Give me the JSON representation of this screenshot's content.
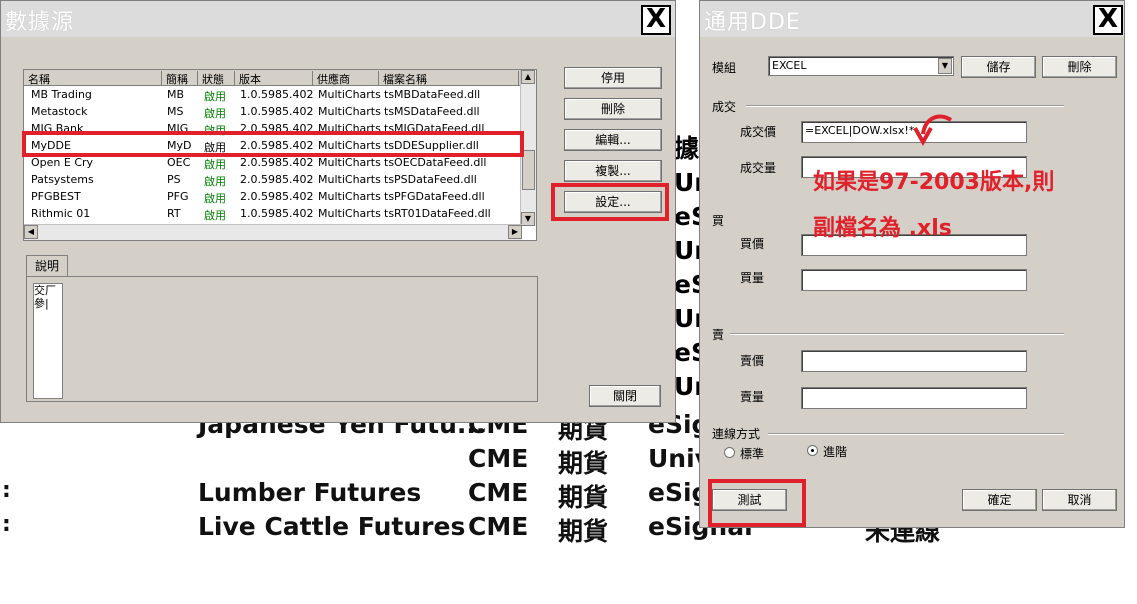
{
  "background": {
    "rows": [
      {
        "colon": "",
        "name": "Japanese Yen Futu...",
        "exchange": "CME",
        "type": "期貨",
        "feed": "eSig",
        "status": ""
      },
      {
        "colon": "",
        "name": "",
        "exchange": "CME",
        "type": "期貨",
        "feed": "Univ",
        "status": ""
      },
      {
        "colon": ":",
        "name": "Lumber Futures",
        "exchange": "CME",
        "type": "期貨",
        "feed": "eSig",
        "status": ""
      },
      {
        "colon": ":",
        "name": "Live Cattle Futures",
        "exchange": "CME",
        "type": "期貨",
        "feed": "eSignal",
        "status": "未連線"
      }
    ],
    "side_fragments": [
      "據",
      "Univ",
      "eSig",
      "Univ",
      "eSig",
      "Univ",
      "eSig",
      "Univ"
    ]
  },
  "datasource_window": {
    "title": "數據源",
    "close": "X",
    "columns": [
      "名稱",
      "簡稱",
      "狀態",
      "版本",
      "供應商",
      "檔案名稱"
    ],
    "rows": [
      {
        "name": "MB Trading",
        "short": "MB",
        "status": "啟用",
        "version": "1.0.5985.402",
        "vendor": "MultiCharts",
        "file": "tsMBDataFeed.dll"
      },
      {
        "name": "Metastock",
        "short": "MS",
        "status": "啟用",
        "version": "1.0.5985.402",
        "vendor": "MultiCharts",
        "file": "tsMSDataFeed.dll"
      },
      {
        "name": "MIG Bank",
        "short": "MIG",
        "status": "啟用",
        "version": "2.0.5985.402",
        "vendor": "MultiCharts",
        "file": "tsMIGDataFeed.dll"
      },
      {
        "name": "MyDDE",
        "short": "MyD",
        "status": "啟用",
        "version": "2.0.5985.402",
        "vendor": "MultiCharts",
        "file": "tsDDESupplier.dll"
      },
      {
        "name": "Open E Cry",
        "short": "OEC",
        "status": "啟用",
        "version": "2.0.5985.402",
        "vendor": "MultiCharts",
        "file": "tsOECDataFeed.dll"
      },
      {
        "name": "Patsystems",
        "short": "PS",
        "status": "啟用",
        "version": "2.0.5985.402",
        "vendor": "MultiCharts",
        "file": "tsPSDataFeed.dll"
      },
      {
        "name": "PFGBEST",
        "short": "PFG",
        "status": "啟用",
        "version": "2.0.5985.402",
        "vendor": "MultiCharts",
        "file": "tsPFGDataFeed.dll"
      },
      {
        "name": "Rithmic 01",
        "short": "RT",
        "status": "啟用",
        "version": "1.0.5985.402",
        "vendor": "MultiCharts",
        "file": "tsRT01DataFeed.dll"
      }
    ],
    "buttons": {
      "disable": "停用",
      "delete": "刪除",
      "edit": "編輯...",
      "copy": "複製...",
      "settings": "設定...",
      "close": "關閉"
    },
    "desc_tab": "說明",
    "desc_text": [
      "交厂",
      "參|"
    ]
  },
  "dde_window": {
    "title": "通用DDE",
    "close": "X",
    "template_label": "模組",
    "template_value": "EXCEL",
    "save": "儲存",
    "delete": "刪除",
    "trade_group": "成交",
    "trade_price_label": "成交價",
    "trade_price_value": "=EXCEL|DOW.xlsx!*",
    "trade_volume_label": "成交量",
    "buy_group": "買",
    "bid_price_label": "買價",
    "bid_volume_label": "買量",
    "sell_group": "賣",
    "ask_price_label": "賣價",
    "ask_volume_label": "賣量",
    "conn_group": "連線方式",
    "radio_standard": "標準",
    "radio_advanced": "進階",
    "test": "測試",
    "ok": "確定",
    "cancel": "取消"
  },
  "annotation": {
    "line1": "如果是97-2003版本,則",
    "line2": "副檔名為  .xls",
    "color": "#e0202a"
  }
}
